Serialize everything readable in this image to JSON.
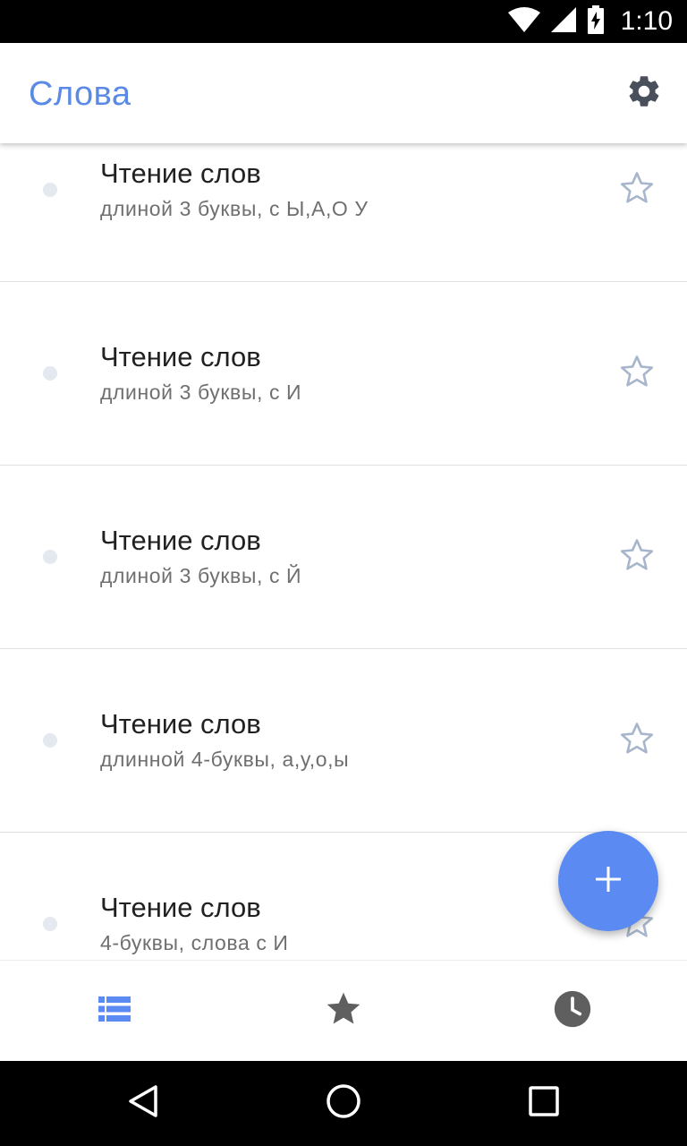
{
  "status_bar": {
    "time": "1:10",
    "icons": [
      "wifi-icon",
      "cell-signal-icon",
      "battery-charging-icon"
    ]
  },
  "app_bar": {
    "title": "Слова",
    "title_color": "#5b8ae6",
    "settings_icon": "gear-icon"
  },
  "list": {
    "items": [
      {
        "title": "Чтение слов",
        "subtitle": "длиной 3 буквы, с Ы,А,О У",
        "starred": false
      },
      {
        "title": "Чтение слов",
        "subtitle": "длиной 3 буквы, с И",
        "starred": false
      },
      {
        "title": "Чтение слов",
        "subtitle": "длиной 3 буквы, с Й",
        "starred": false
      },
      {
        "title": "Чтение слов",
        "subtitle": "длинной 4-буквы, а,у,о,ы",
        "starred": false
      },
      {
        "title": "Чтение слов",
        "subtitle": "4-буквы, слова с И",
        "starred": false
      }
    ]
  },
  "fab": {
    "icon": "plus-icon",
    "color": "#5a8af2"
  },
  "bottom_nav": {
    "items": [
      {
        "icon": "list-icon",
        "active": true
      },
      {
        "icon": "star-icon",
        "active": false
      },
      {
        "icon": "clock-icon",
        "active": false
      }
    ],
    "active_color": "#5a8af2",
    "inactive_color": "#5f5f5f"
  },
  "system_nav": {
    "icons": [
      "back-icon",
      "home-icon",
      "recents-icon"
    ]
  }
}
